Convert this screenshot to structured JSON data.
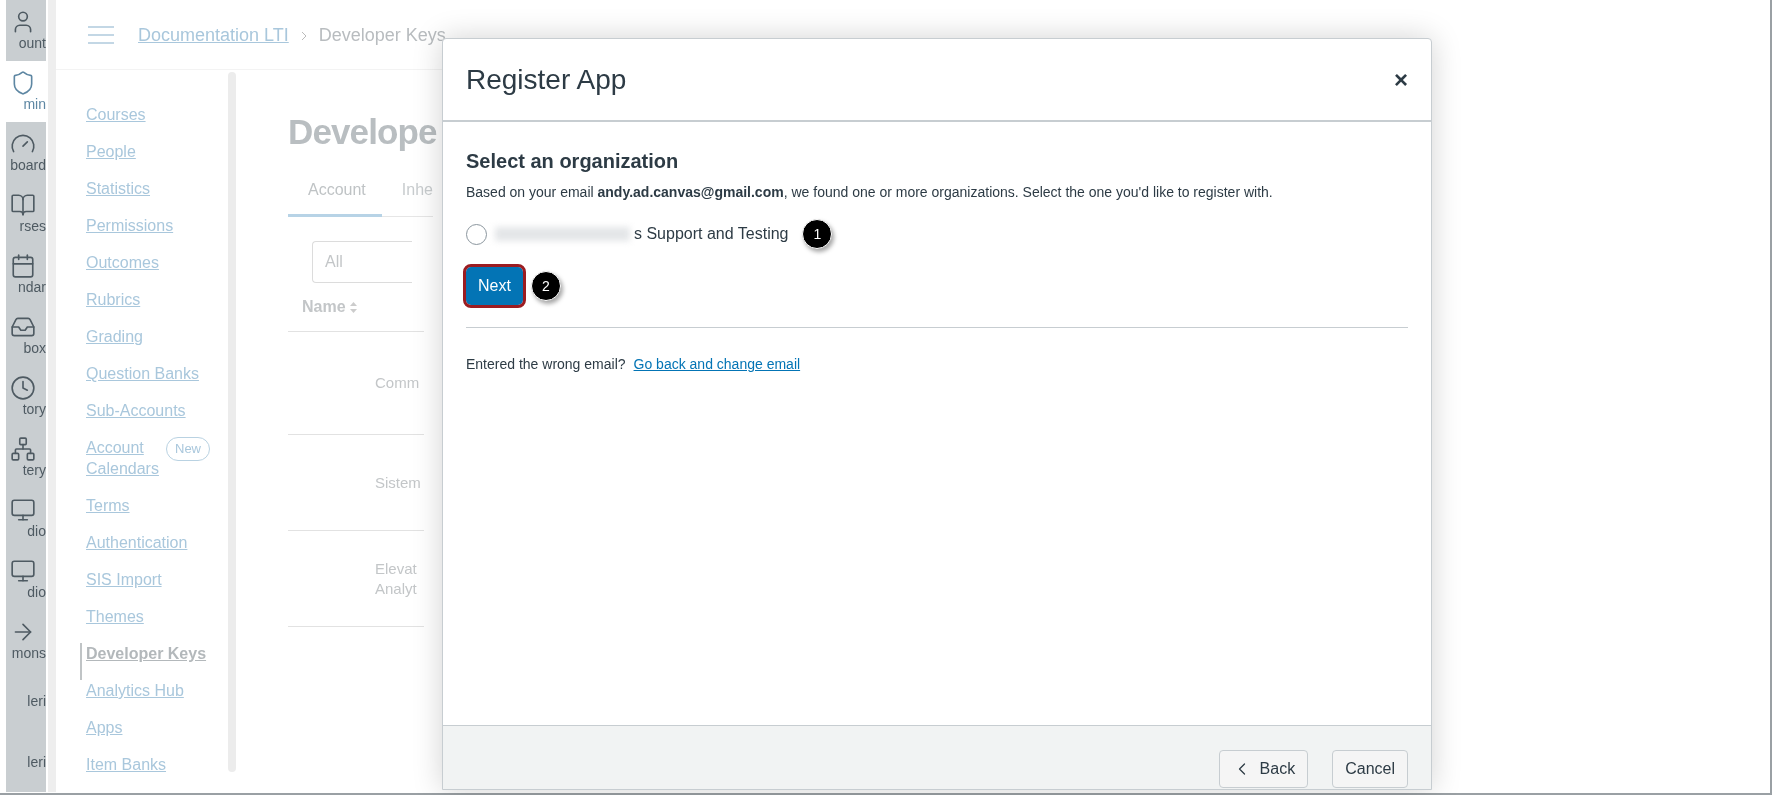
{
  "global_nav": [
    {
      "label": "ount",
      "selected": false
    },
    {
      "label": "min",
      "selected": true
    },
    {
      "label": "board",
      "selected": false
    },
    {
      "label": "rses",
      "selected": false
    },
    {
      "label": "ndar",
      "selected": false
    },
    {
      "label": "box",
      "selected": false
    },
    {
      "label": "tory",
      "selected": false
    },
    {
      "label": "tery",
      "selected": false
    },
    {
      "label": "dio",
      "selected": false
    },
    {
      "label": "dio",
      "selected": false
    },
    {
      "label": "mons",
      "selected": false
    },
    {
      "label": "leri",
      "selected": false
    },
    {
      "label": "leri",
      "selected": false
    }
  ],
  "breadcrumb": [
    {
      "label": "Documentation LTI",
      "kind": "link"
    },
    {
      "label": "Developer Keys",
      "kind": "current"
    }
  ],
  "sidebar": {
    "items": [
      {
        "label": "Courses",
        "selected": false
      },
      {
        "label": "People",
        "selected": false
      },
      {
        "label": "Statistics",
        "selected": false
      },
      {
        "label": "Permissions",
        "selected": false
      },
      {
        "label": "Outcomes",
        "selected": false
      },
      {
        "label": "Rubrics",
        "selected": false
      },
      {
        "label": "Grading",
        "selected": false
      },
      {
        "label": "Question Banks",
        "selected": false
      },
      {
        "label": "Sub-Accounts",
        "selected": false
      },
      {
        "label": "Account Calendars",
        "selected": false,
        "badge": "New"
      },
      {
        "label": "Terms",
        "selected": false
      },
      {
        "label": "Authentication",
        "selected": false
      },
      {
        "label": "SIS Import",
        "selected": false
      },
      {
        "label": "Themes",
        "selected": false
      },
      {
        "label": "Developer Keys",
        "selected": true
      },
      {
        "label": "Analytics Hub",
        "selected": false
      },
      {
        "label": "Apps",
        "selected": false
      },
      {
        "label": "Item Banks",
        "selected": false
      }
    ]
  },
  "page": {
    "heading": "Develope",
    "tabs": [
      {
        "label": "Account",
        "selected": true
      },
      {
        "label": "Inhe",
        "selected": false
      }
    ],
    "filter": {
      "value": "All"
    },
    "table": {
      "columns": [
        "Name"
      ],
      "rows": [
        [
          "Comm"
        ],
        [
          "Sistem"
        ],
        [
          "Elevat\nAnalyt"
        ]
      ]
    }
  },
  "dialog": {
    "title": "Register App",
    "close": "×",
    "heading": "Select an organization",
    "description": "Based on your email **andy.ad.canvas@gmail.com**, we found one or more organizations. Select the one you'd like to register with.",
    "options": [
      {
        "label": "s Support and Testing",
        "selected": false,
        "redacted": true,
        "callout": "1"
      }
    ],
    "next": {
      "label": "Next",
      "callout": "2"
    },
    "footnote": "Entered the wrong email?",
    "footnote_link": "Go back and change email",
    "buttons": [
      {
        "label": "Back",
        "kind": "back"
      },
      {
        "label": "Cancel",
        "kind": "plain"
      }
    ]
  }
}
